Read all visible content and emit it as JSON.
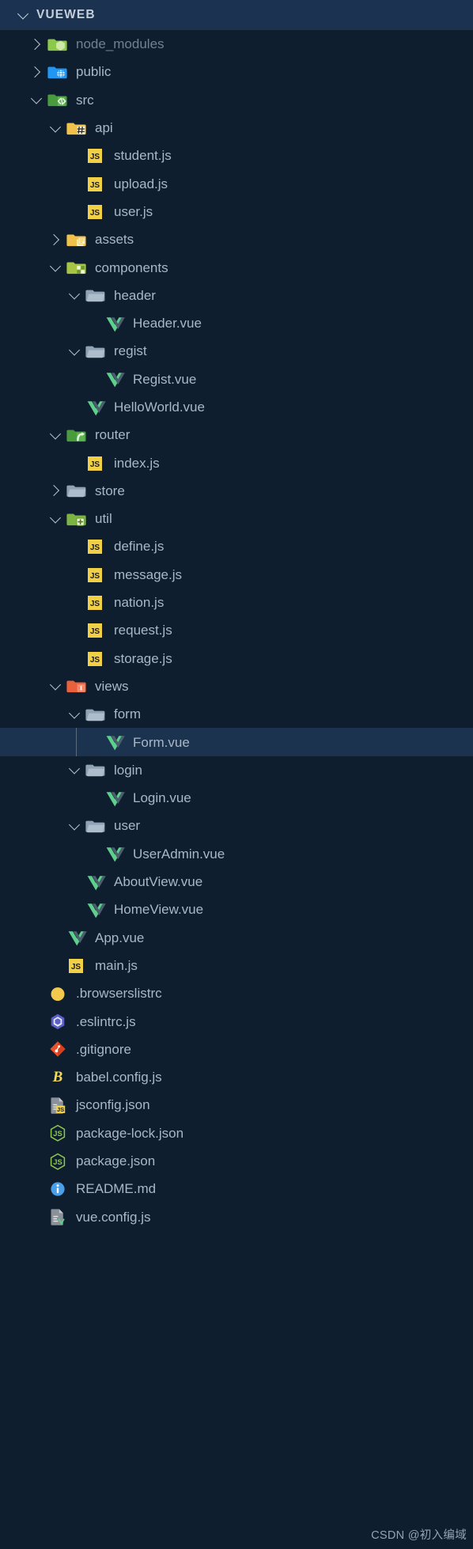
{
  "header": {
    "title": "VUEWEB",
    "twisty": "chevron-down-icon",
    "expanded": true
  },
  "colors": {
    "background": "#0e1e2e",
    "header_background": "#1b3350",
    "selection_background": "#1c3350",
    "text": "#a9b7c6",
    "text_dim": "#73808e",
    "indent_guide": "#5a6b7d",
    "js_yellow": "#f1d045",
    "vue_green": "#5fcf8c",
    "vue_dark": "#4a5f6e",
    "folder_grey": "#90a4b5",
    "folder_green": "#7cb342",
    "folder_blue": "#2196f3",
    "folder_yellow": "#f0c14b",
    "folder_orange": "#e8603c",
    "eslint_purple": "#5b5fc7",
    "git_orange": "#e8532c",
    "babel_yellow": "#f5da55",
    "node_green": "#8cc84b",
    "info_blue": "#4a9fe8"
  },
  "watermark": "CSDN @初入编域",
  "tree": [
    {
      "name": "node_modules",
      "type": "folder",
      "icon": "folder-node-modules-icon",
      "depth": 1,
      "state": "collapsed",
      "twisty": "chevron-right-icon",
      "dim": true,
      "selected": false
    },
    {
      "name": "public",
      "type": "folder",
      "icon": "folder-public-icon",
      "depth": 1,
      "state": "collapsed",
      "twisty": "chevron-right-icon",
      "dim": false,
      "selected": false
    },
    {
      "name": "src",
      "type": "folder",
      "icon": "folder-src-icon",
      "depth": 1,
      "state": "expanded",
      "twisty": "chevron-down-icon",
      "dim": false,
      "selected": false
    },
    {
      "name": "api",
      "type": "folder",
      "icon": "folder-api-icon",
      "depth": 2,
      "state": "expanded",
      "twisty": "chevron-down-icon",
      "dim": false,
      "selected": false
    },
    {
      "name": "student.js",
      "type": "file",
      "icon": "js-file-icon",
      "depth": 3,
      "state": "none",
      "twisty": "",
      "dim": false,
      "selected": false
    },
    {
      "name": "upload.js",
      "type": "file",
      "icon": "js-file-icon",
      "depth": 3,
      "state": "none",
      "twisty": "",
      "dim": false,
      "selected": false
    },
    {
      "name": "user.js",
      "type": "file",
      "icon": "js-file-icon",
      "depth": 3,
      "state": "none",
      "twisty": "",
      "dim": false,
      "selected": false
    },
    {
      "name": "assets",
      "type": "folder",
      "icon": "folder-assets-icon",
      "depth": 2,
      "state": "collapsed",
      "twisty": "chevron-right-icon",
      "dim": false,
      "selected": false
    },
    {
      "name": "components",
      "type": "folder",
      "icon": "folder-components-icon",
      "depth": 2,
      "state": "expanded",
      "twisty": "chevron-down-icon",
      "dim": false,
      "selected": false
    },
    {
      "name": "header",
      "type": "folder",
      "icon": "folder-plain-icon",
      "depth": 3,
      "state": "expanded",
      "twisty": "chevron-down-icon",
      "dim": false,
      "selected": false
    },
    {
      "name": "Header.vue",
      "type": "file",
      "icon": "vue-file-icon",
      "depth": 4,
      "state": "none",
      "twisty": "",
      "dim": false,
      "selected": false
    },
    {
      "name": "regist",
      "type": "folder",
      "icon": "folder-plain-icon",
      "depth": 3,
      "state": "expanded",
      "twisty": "chevron-down-icon",
      "dim": false,
      "selected": false
    },
    {
      "name": "Regist.vue",
      "type": "file",
      "icon": "vue-file-icon",
      "depth": 4,
      "state": "none",
      "twisty": "",
      "dim": false,
      "selected": false
    },
    {
      "name": "HelloWorld.vue",
      "type": "file",
      "icon": "vue-file-icon",
      "depth": 3,
      "state": "none",
      "twisty": "",
      "dim": false,
      "selected": false
    },
    {
      "name": "router",
      "type": "folder",
      "icon": "folder-router-icon",
      "depth": 2,
      "state": "expanded",
      "twisty": "chevron-down-icon",
      "dim": false,
      "selected": false
    },
    {
      "name": "index.js",
      "type": "file",
      "icon": "js-file-icon",
      "depth": 3,
      "state": "none",
      "twisty": "",
      "dim": false,
      "selected": false
    },
    {
      "name": "store",
      "type": "folder",
      "icon": "folder-plain-icon",
      "depth": 2,
      "state": "collapsed",
      "twisty": "chevron-right-icon",
      "dim": false,
      "selected": false
    },
    {
      "name": "util",
      "type": "folder",
      "icon": "folder-util-icon",
      "depth": 2,
      "state": "expanded",
      "twisty": "chevron-down-icon",
      "dim": false,
      "selected": false
    },
    {
      "name": "define.js",
      "type": "file",
      "icon": "js-file-icon",
      "depth": 3,
      "state": "none",
      "twisty": "",
      "dim": false,
      "selected": false
    },
    {
      "name": "message.js",
      "type": "file",
      "icon": "js-file-icon",
      "depth": 3,
      "state": "none",
      "twisty": "",
      "dim": false,
      "selected": false
    },
    {
      "name": "nation.js",
      "type": "file",
      "icon": "js-file-icon",
      "depth": 3,
      "state": "none",
      "twisty": "",
      "dim": false,
      "selected": false
    },
    {
      "name": "request.js",
      "type": "file",
      "icon": "js-file-icon",
      "depth": 3,
      "state": "none",
      "twisty": "",
      "dim": false,
      "selected": false
    },
    {
      "name": "storage.js",
      "type": "file",
      "icon": "js-file-icon",
      "depth": 3,
      "state": "none",
      "twisty": "",
      "dim": false,
      "selected": false
    },
    {
      "name": "views",
      "type": "folder",
      "icon": "folder-views-icon",
      "depth": 2,
      "state": "expanded",
      "twisty": "chevron-down-icon",
      "dim": false,
      "selected": false
    },
    {
      "name": "form",
      "type": "folder",
      "icon": "folder-plain-icon",
      "depth": 3,
      "state": "expanded",
      "twisty": "chevron-down-icon",
      "dim": false,
      "selected": false
    },
    {
      "name": "Form.vue",
      "type": "file",
      "icon": "vue-file-icon",
      "depth": 4,
      "state": "none",
      "twisty": "",
      "dim": false,
      "selected": true
    },
    {
      "name": "login",
      "type": "folder",
      "icon": "folder-plain-icon",
      "depth": 3,
      "state": "expanded",
      "twisty": "chevron-down-icon",
      "dim": false,
      "selected": false
    },
    {
      "name": "Login.vue",
      "type": "file",
      "icon": "vue-file-icon",
      "depth": 4,
      "state": "none",
      "twisty": "",
      "dim": false,
      "selected": false
    },
    {
      "name": "user",
      "type": "folder",
      "icon": "folder-plain-icon",
      "depth": 3,
      "state": "expanded",
      "twisty": "chevron-down-icon",
      "dim": false,
      "selected": false
    },
    {
      "name": "UserAdmin.vue",
      "type": "file",
      "icon": "vue-file-icon",
      "depth": 4,
      "state": "none",
      "twisty": "",
      "dim": false,
      "selected": false
    },
    {
      "name": "AboutView.vue",
      "type": "file",
      "icon": "vue-file-icon",
      "depth": 3,
      "state": "none",
      "twisty": "",
      "dim": false,
      "selected": false
    },
    {
      "name": "HomeView.vue",
      "type": "file",
      "icon": "vue-file-icon",
      "depth": 3,
      "state": "none",
      "twisty": "",
      "dim": false,
      "selected": false
    },
    {
      "name": "App.vue",
      "type": "file",
      "icon": "vue-file-icon",
      "depth": 2,
      "state": "none",
      "twisty": "",
      "dim": false,
      "selected": false
    },
    {
      "name": "main.js",
      "type": "file",
      "icon": "js-file-icon",
      "depth": 2,
      "state": "none",
      "twisty": "",
      "dim": false,
      "selected": false
    },
    {
      "name": ".browserslistrc",
      "type": "file",
      "icon": "browserslist-icon",
      "depth": 1,
      "state": "none",
      "twisty": "",
      "dim": false,
      "selected": false
    },
    {
      "name": ".eslintrc.js",
      "type": "file",
      "icon": "eslint-icon",
      "depth": 1,
      "state": "none",
      "twisty": "",
      "dim": false,
      "selected": false
    },
    {
      "name": ".gitignore",
      "type": "file",
      "icon": "git-icon",
      "depth": 1,
      "state": "none",
      "twisty": "",
      "dim": false,
      "selected": false
    },
    {
      "name": "babel.config.js",
      "type": "file",
      "icon": "babel-icon",
      "depth": 1,
      "state": "none",
      "twisty": "",
      "dim": false,
      "selected": false
    },
    {
      "name": "jsconfig.json",
      "type": "file",
      "icon": "jsconfig-icon",
      "depth": 1,
      "state": "none",
      "twisty": "",
      "dim": false,
      "selected": false
    },
    {
      "name": "package-lock.json",
      "type": "file",
      "icon": "nodejs-icon",
      "depth": 1,
      "state": "none",
      "twisty": "",
      "dim": false,
      "selected": false
    },
    {
      "name": "package.json",
      "type": "file",
      "icon": "nodejs-icon",
      "depth": 1,
      "state": "none",
      "twisty": "",
      "dim": false,
      "selected": false
    },
    {
      "name": "README.md",
      "type": "file",
      "icon": "readme-info-icon",
      "depth": 1,
      "state": "none",
      "twisty": "",
      "dim": false,
      "selected": false
    },
    {
      "name": "vue.config.js",
      "type": "file",
      "icon": "vue-config-icon",
      "depth": 1,
      "state": "none",
      "twisty": "",
      "dim": false,
      "selected": false
    }
  ]
}
